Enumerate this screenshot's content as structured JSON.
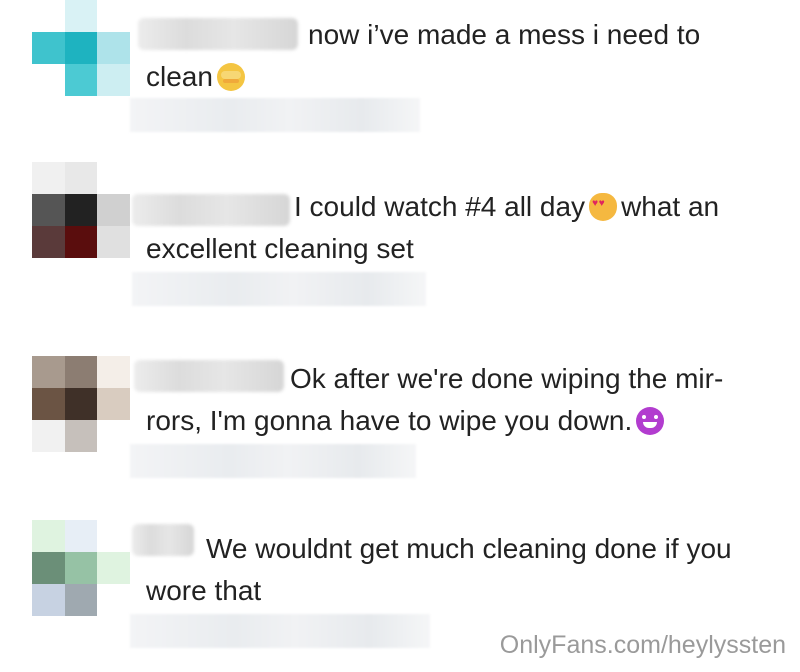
{
  "comments": [
    {
      "username_hidden": true,
      "lines": [
        "now i’ve made a mess i need to",
        "clean"
      ],
      "emoji": "face-with-hand-over-eyes-icon"
    },
    {
      "username_hidden": true,
      "line1_a": "I could watch #4 all day",
      "line1_b": "what an",
      "line2": "excellent cleaning set",
      "emoji": "heart-eyes-cat-icon"
    },
    {
      "username_hidden": true,
      "line1": "Ok after we're done wiping the mir-",
      "line2": "rors, I'm gonna have to wipe you down.",
      "emoji": "smiling-devil-icon"
    },
    {
      "username_hidden": true,
      "line1": "We wouldnt get much cleaning done if you",
      "line2": "wore that"
    }
  ],
  "watermark": "OnlyFans.com/heylyssten",
  "colors": {
    "text": "#222222",
    "watermark": "#9a9a9a",
    "avatar1": [
      "#ffffff",
      "#d9f2f5",
      "#ffffff",
      "#3fc3cd",
      "#1eb3c0",
      "#aee3ea",
      "#ffffff",
      "#4ccad3",
      "#cdeef2"
    ],
    "avatar2": [
      "#f0f0f0",
      "#e8e8e8",
      "#ffffff",
      "#555555",
      "#222222",
      "#d0d0d0",
      "#5a3a3a",
      "#5a0d0d",
      "#e0e0e0"
    ],
    "avatar3": [
      "#a89a8e",
      "#8c7d72",
      "#f4eee8",
      "#6b5444",
      "#3f3028",
      "#d9ccc0",
      "#f1f1f1",
      "#c6c0bb",
      "#ffffff"
    ],
    "avatar4": [
      "#dff3e0",
      "#e7eef6",
      "#ffffff",
      "#6b8f78",
      "#96c2a5",
      "#dff3e0",
      "#c7d2e2",
      "#9fa9b0",
      "#ffffff"
    ]
  }
}
